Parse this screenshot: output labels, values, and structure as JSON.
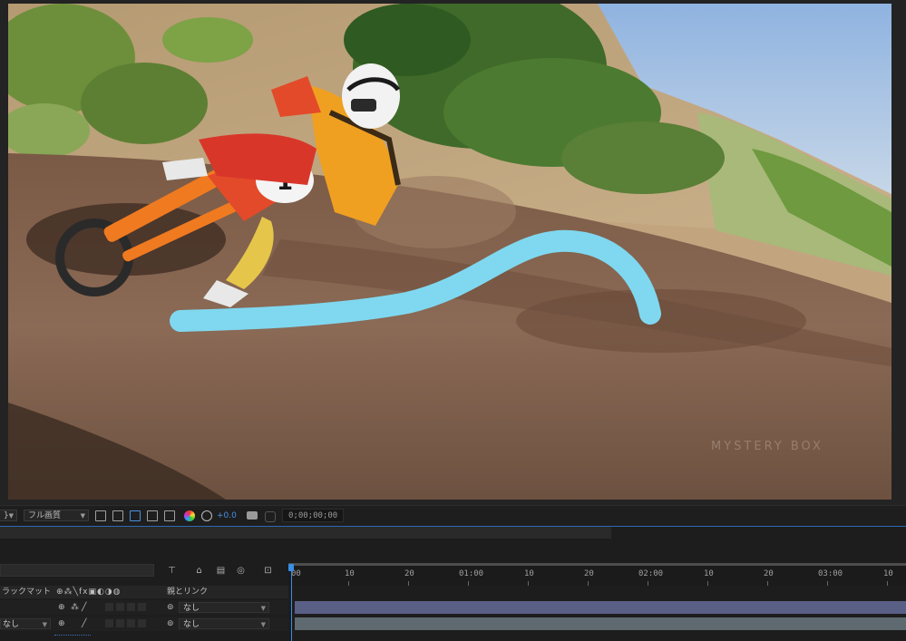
{
  "toolbar": {
    "zoom_dropdown": "}",
    "quality_dropdown": "フル画質",
    "exposure_value": "+0.0",
    "current_time": "0;00;00;00"
  },
  "timeline": {
    "column_header_left": "ラックマット",
    "column_header_right": "親とリンク",
    "ruler_ticks": [
      "00",
      "10",
      "20",
      "01:00",
      "10",
      "20",
      "02:00",
      "10",
      "20",
      "03:00",
      "10"
    ],
    "layers": [
      {
        "name": "",
        "parent": "なし"
      },
      {
        "name": "なし",
        "parent": "なし"
      }
    ]
  },
  "colors": {
    "accent": "#3a8ee6",
    "stroke": "#7fd8ef",
    "track_purple": "#5a5f86",
    "track_gray": "#5e6a70"
  }
}
